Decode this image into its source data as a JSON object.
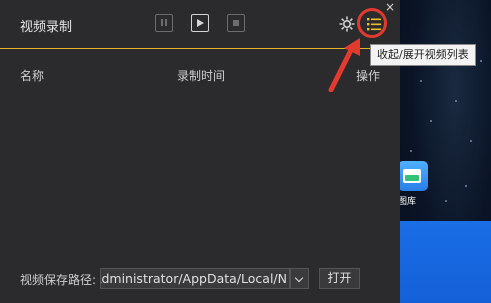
{
  "window": {
    "title": "视频录制",
    "close_glyph": "×"
  },
  "toolbar": {
    "pause": "pause-icon",
    "play": "play-icon",
    "stop": "stop-icon",
    "settings": "gear-icon",
    "list": "list-icon",
    "list_tooltip": "收起/展开视频列表"
  },
  "table": {
    "columns": [
      "名称",
      "录制时间",
      "操作"
    ],
    "rows": []
  },
  "footer": {
    "path_label": "视频保存路径:",
    "path_value": "Administrator/AppData/Local/N",
    "open_label": "打开"
  },
  "desktop": {
    "app_label": "图库"
  },
  "colors": {
    "panel_bg": "#2b2b2d",
    "accent": "#e5b22a",
    "annotation": "#e23b2e",
    "desktop_blue": "#1a6ee6"
  }
}
